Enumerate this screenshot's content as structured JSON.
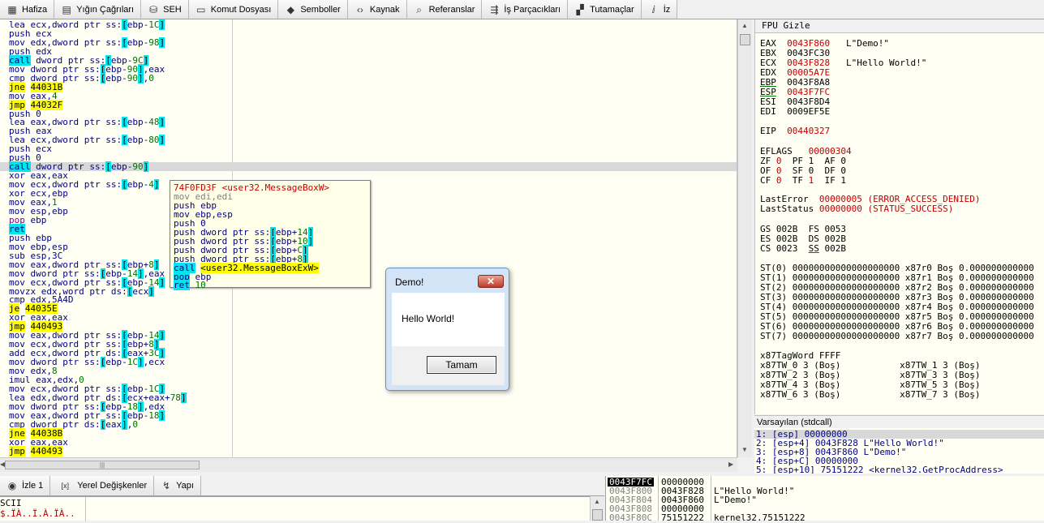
{
  "tabs": [
    {
      "label": "Hafiza",
      "icon": "memory-icon"
    },
    {
      "label": "Yığın Çağrıları",
      "icon": "callstack-icon"
    },
    {
      "label": "SEH",
      "icon": "seh-icon"
    },
    {
      "label": "Komut Dosyası",
      "icon": "script-icon"
    },
    {
      "label": "Semboller",
      "icon": "symbols-icon"
    },
    {
      "label": "Kaynak",
      "icon": "source-icon"
    },
    {
      "label": "Referanslar",
      "icon": "references-icon"
    },
    {
      "label": "İş Parçacıkları",
      "icon": "threads-icon"
    },
    {
      "label": "Tutamaçlar",
      "icon": "handles-icon"
    },
    {
      "label": "İz",
      "icon": "trace-icon"
    }
  ],
  "disasm": [
    "lea ecx,dword ptr ss:[ebp-1C]",
    "push ecx",
    "mov edx,dword ptr ss:[ebp-98]",
    "push edx",
    "call dword ptr ss:[ebp-9C]",
    "mov dword ptr ss:[ebp-90],eax",
    "cmp dword ptr ss:[ebp-90],0",
    "jne 44031B",
    "mov eax,4",
    "jmp 44032F",
    "push 0",
    "lea eax,dword ptr ss:[ebp-48]",
    "push eax",
    "lea ecx,dword ptr ss:[ebp-80]",
    "push ecx",
    "push 0",
    "call dword ptr ss:[ebp-90]",
    "xor eax,eax",
    "mov ecx,dword ptr ss:[ebp-4]",
    "xor ecx,ebp",
    "mov eax,1",
    "mov esp,ebp",
    "pop ebp",
    "ret",
    "push ebp",
    "mov ebp,esp",
    "sub esp,3C",
    "mov eax,dword ptr ss:[ebp+8]",
    "mov dword ptr ss:[ebp-14],eax",
    "mov ecx,dword ptr ss:[ebp-14]",
    "movzx edx,word ptr ds:[ecx]",
    "cmp edx,5A4D",
    "je 44035E",
    "xor eax,eax",
    "jmp 440493",
    "mov eax,dword ptr ss:[ebp-14]",
    "mov ecx,dword ptr ss:[ebp+8]",
    "add ecx,dword ptr ds:[eax+3C]",
    "mov dword ptr ss:[ebp-1C],ecx",
    "mov edx,8",
    "imul eax,edx,0",
    "mov ecx,dword ptr ss:[ebp-1C]",
    "lea edx,dword ptr ds:[ecx+eax+78]",
    "mov dword ptr ss:[ebp-18],edx",
    "mov eax,dword ptr ss:[ebp-18]",
    "cmp dword ptr ds:[eax],0",
    "jne 44038B",
    "xor eax,eax",
    "jmp 440493"
  ],
  "popup": [
    "74F0FD3F <user32.MessageBoxW>",
    "mov edi,edi",
    "push ebp",
    "mov ebp,esp",
    "push 0",
    "push dword ptr ss:[ebp+14]",
    "push dword ptr ss:[ebp+10]",
    "push dword ptr ss:[ebp+C]",
    "push dword ptr ss:[ebp+8]",
    "call <user32.MessageBoxExW>",
    "pop ebp",
    "ret 10"
  ],
  "dialog": {
    "title": "Demo!",
    "message": "Hello World!",
    "button": "Tamam",
    "close": "✕"
  },
  "regs": {
    "header": "FPU Gizle",
    "gp": [
      {
        "n": "EAX",
        "v": "0043F860",
        "c": "L\"Demo!\"",
        "red": true
      },
      {
        "n": "EBX",
        "v": "0043FC30",
        "c": "",
        "red": false
      },
      {
        "n": "ECX",
        "v": "0043F828",
        "c": "L\"Hello World!\"",
        "red": true
      },
      {
        "n": "EDX",
        "v": "00005A7E",
        "c": "",
        "red": true
      },
      {
        "n": "EBP",
        "v": "0043F8A8",
        "c": "",
        "red": false
      },
      {
        "n": "ESP",
        "v": "0043F7FC",
        "c": "",
        "red": true
      },
      {
        "n": "ESI",
        "v": "0043F8D4",
        "c": "",
        "red": false
      },
      {
        "n": "EDI",
        "v": "0009EF5E",
        "c": "",
        "red": false
      }
    ],
    "eip": {
      "n": "EIP",
      "v": "00440327"
    },
    "eflags": {
      "n": "EFLAGS",
      "v": "00000304"
    },
    "flags": [
      "ZF 0  PF 1  AF 0",
      "OF 0  SF 0  DF 0",
      "CF 0  TF 1  IF 1"
    ],
    "lasterror": "LastError  00000005 (ERROR_ACCESS_DENIED)",
    "laststatus": "LastStatus 00000000 (STATUS_SUCCESS)",
    "segs": [
      "GS 002B  FS 0053",
      "ES 002B  DS 002B",
      "CS 0023  SS 002B"
    ],
    "st": [
      "ST(0) 00000000000000000000 x87r0 Boş 0.000000000000",
      "ST(1) 00000000000000000000 x87r1 Boş 0.000000000000",
      "ST(2) 00000000000000000000 x87r2 Boş 0.000000000000",
      "ST(3) 00000000000000000000 x87r3 Boş 0.000000000000",
      "ST(4) 00000000000000000000 x87r4 Boş 0.000000000000",
      "ST(5) 00000000000000000000 x87r5 Boş 0.000000000000",
      "ST(6) 00000000000000000000 x87r6 Boş 0.000000000000",
      "ST(7) 00000000000000000000 x87r7 Boş 0.000000000000"
    ],
    "tagword": "x87TagWord FFFF",
    "tw": [
      "x87TW_0 3 (Boş)           x87TW_1 3 (Boş)",
      "x87TW_2 3 (Boş)           x87TW_3 3 (Boş)",
      "x87TW_4 3 (Boş)           x87TW_5 3 (Boş)",
      "x87TW_6 3 (Boş)           x87TW_7 3 (Boş)"
    ]
  },
  "callconv": {
    "header": "Varsayılan (stdcall)",
    "lines": [
      "1: [esp] 00000000",
      "2: [esp+4] 0043F828 L\"Hello World!\"",
      "3: [esp+8] 0043F860 L\"Demo!\"",
      "4: [esp+C] 00000000",
      "5: [esp+10] 75151222 <kernel32.GetProcAddress>"
    ]
  },
  "bottom_tabs": [
    {
      "label": "İzle 1",
      "icon": "watch-icon"
    },
    {
      "label": "Yerel Değişkenler",
      "icon": "locals-icon"
    },
    {
      "label": "Yapı",
      "icon": "struct-icon"
    }
  ],
  "dump": {
    "col_header": "SCII",
    "row": "$.ÏÀ..Ï.À.ÏÀ.."
  },
  "stack": [
    {
      "addr": "0043F7FC",
      "val": "00000000",
      "c": ""
    },
    {
      "addr": "0043F800",
      "val": "0043F828",
      "c": "L\"Hello World!\""
    },
    {
      "addr": "0043F804",
      "val": "0043F860",
      "c": "L\"Demo!\""
    },
    {
      "addr": "0043F808",
      "val": "00000000",
      "c": ""
    },
    {
      "addr": "0043F80C",
      "val": "75151222",
      "c": "kernel32.75151222"
    }
  ]
}
